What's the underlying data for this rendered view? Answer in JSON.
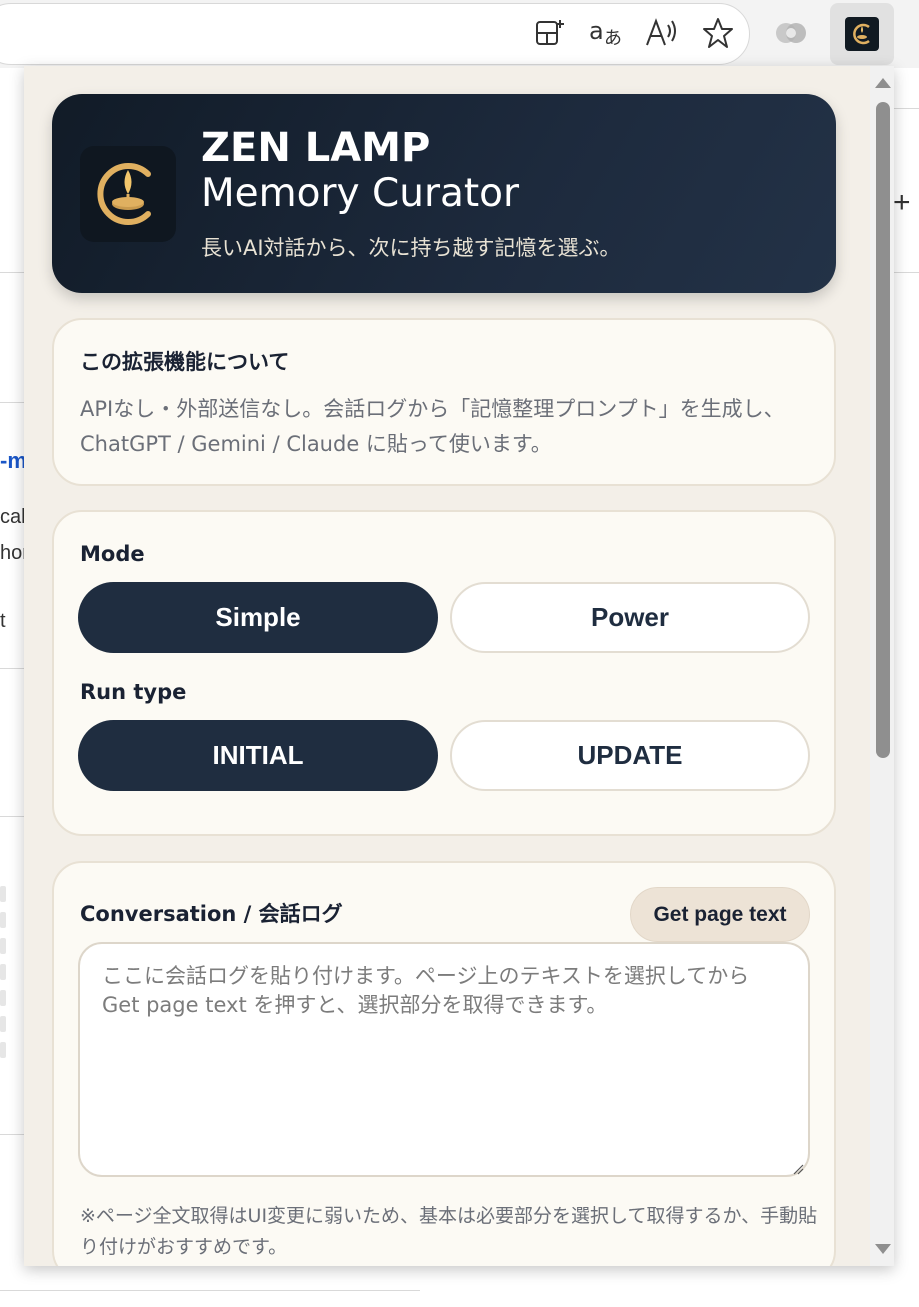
{
  "browser": {
    "toolbar_icons": [
      "add-tab-group-icon",
      "translate-icon",
      "read-aloud-icon",
      "favorite-star-icon",
      "copilot-icon"
    ],
    "extension_icon": "zen-lamp-extension-icon"
  },
  "background_page": {
    "link_fragment": "-m",
    "text_fragments": [
      "cal",
      "hor",
      "t"
    ]
  },
  "popup": {
    "hero": {
      "title": "ZEN LAMP",
      "subtitle": "Memory Curator",
      "tagline": "長いAI対話から、次に持ち越す記憶を選ぶ。"
    },
    "about": {
      "title": "この拡張機能について",
      "body": "APIなし・外部送信なし。会話ログから「記憶整理プロンプト」を生成し、ChatGPT / Gemini / Claude に貼って使います。"
    },
    "mode": {
      "label": "Mode",
      "options": [
        "Simple",
        "Power"
      ],
      "selected": "Simple"
    },
    "run_type": {
      "label": "Run type",
      "options": [
        "INITIAL",
        "UPDATE"
      ],
      "selected": "INITIAL"
    },
    "conversation": {
      "label": "Conversation / 会話ログ",
      "get_page_text_button": "Get page text",
      "placeholder": "ここに会話ログを貼り付けます。ページ上のテキストを選択してから Get page text を押すと、選択部分を取得できます。",
      "value": "",
      "note": "※ページ全文取得はUI変更に弱いため、基本は必要部分を選択して取得するか、手動貼り付けがおすすめです。"
    }
  },
  "colors": {
    "hero_bg": "#1d2a3d",
    "active_segment": "#1f2d40",
    "card_bg": "#fcfaf4",
    "popup_bg": "#f3efe8",
    "lamp_gold": "#e0b060"
  }
}
